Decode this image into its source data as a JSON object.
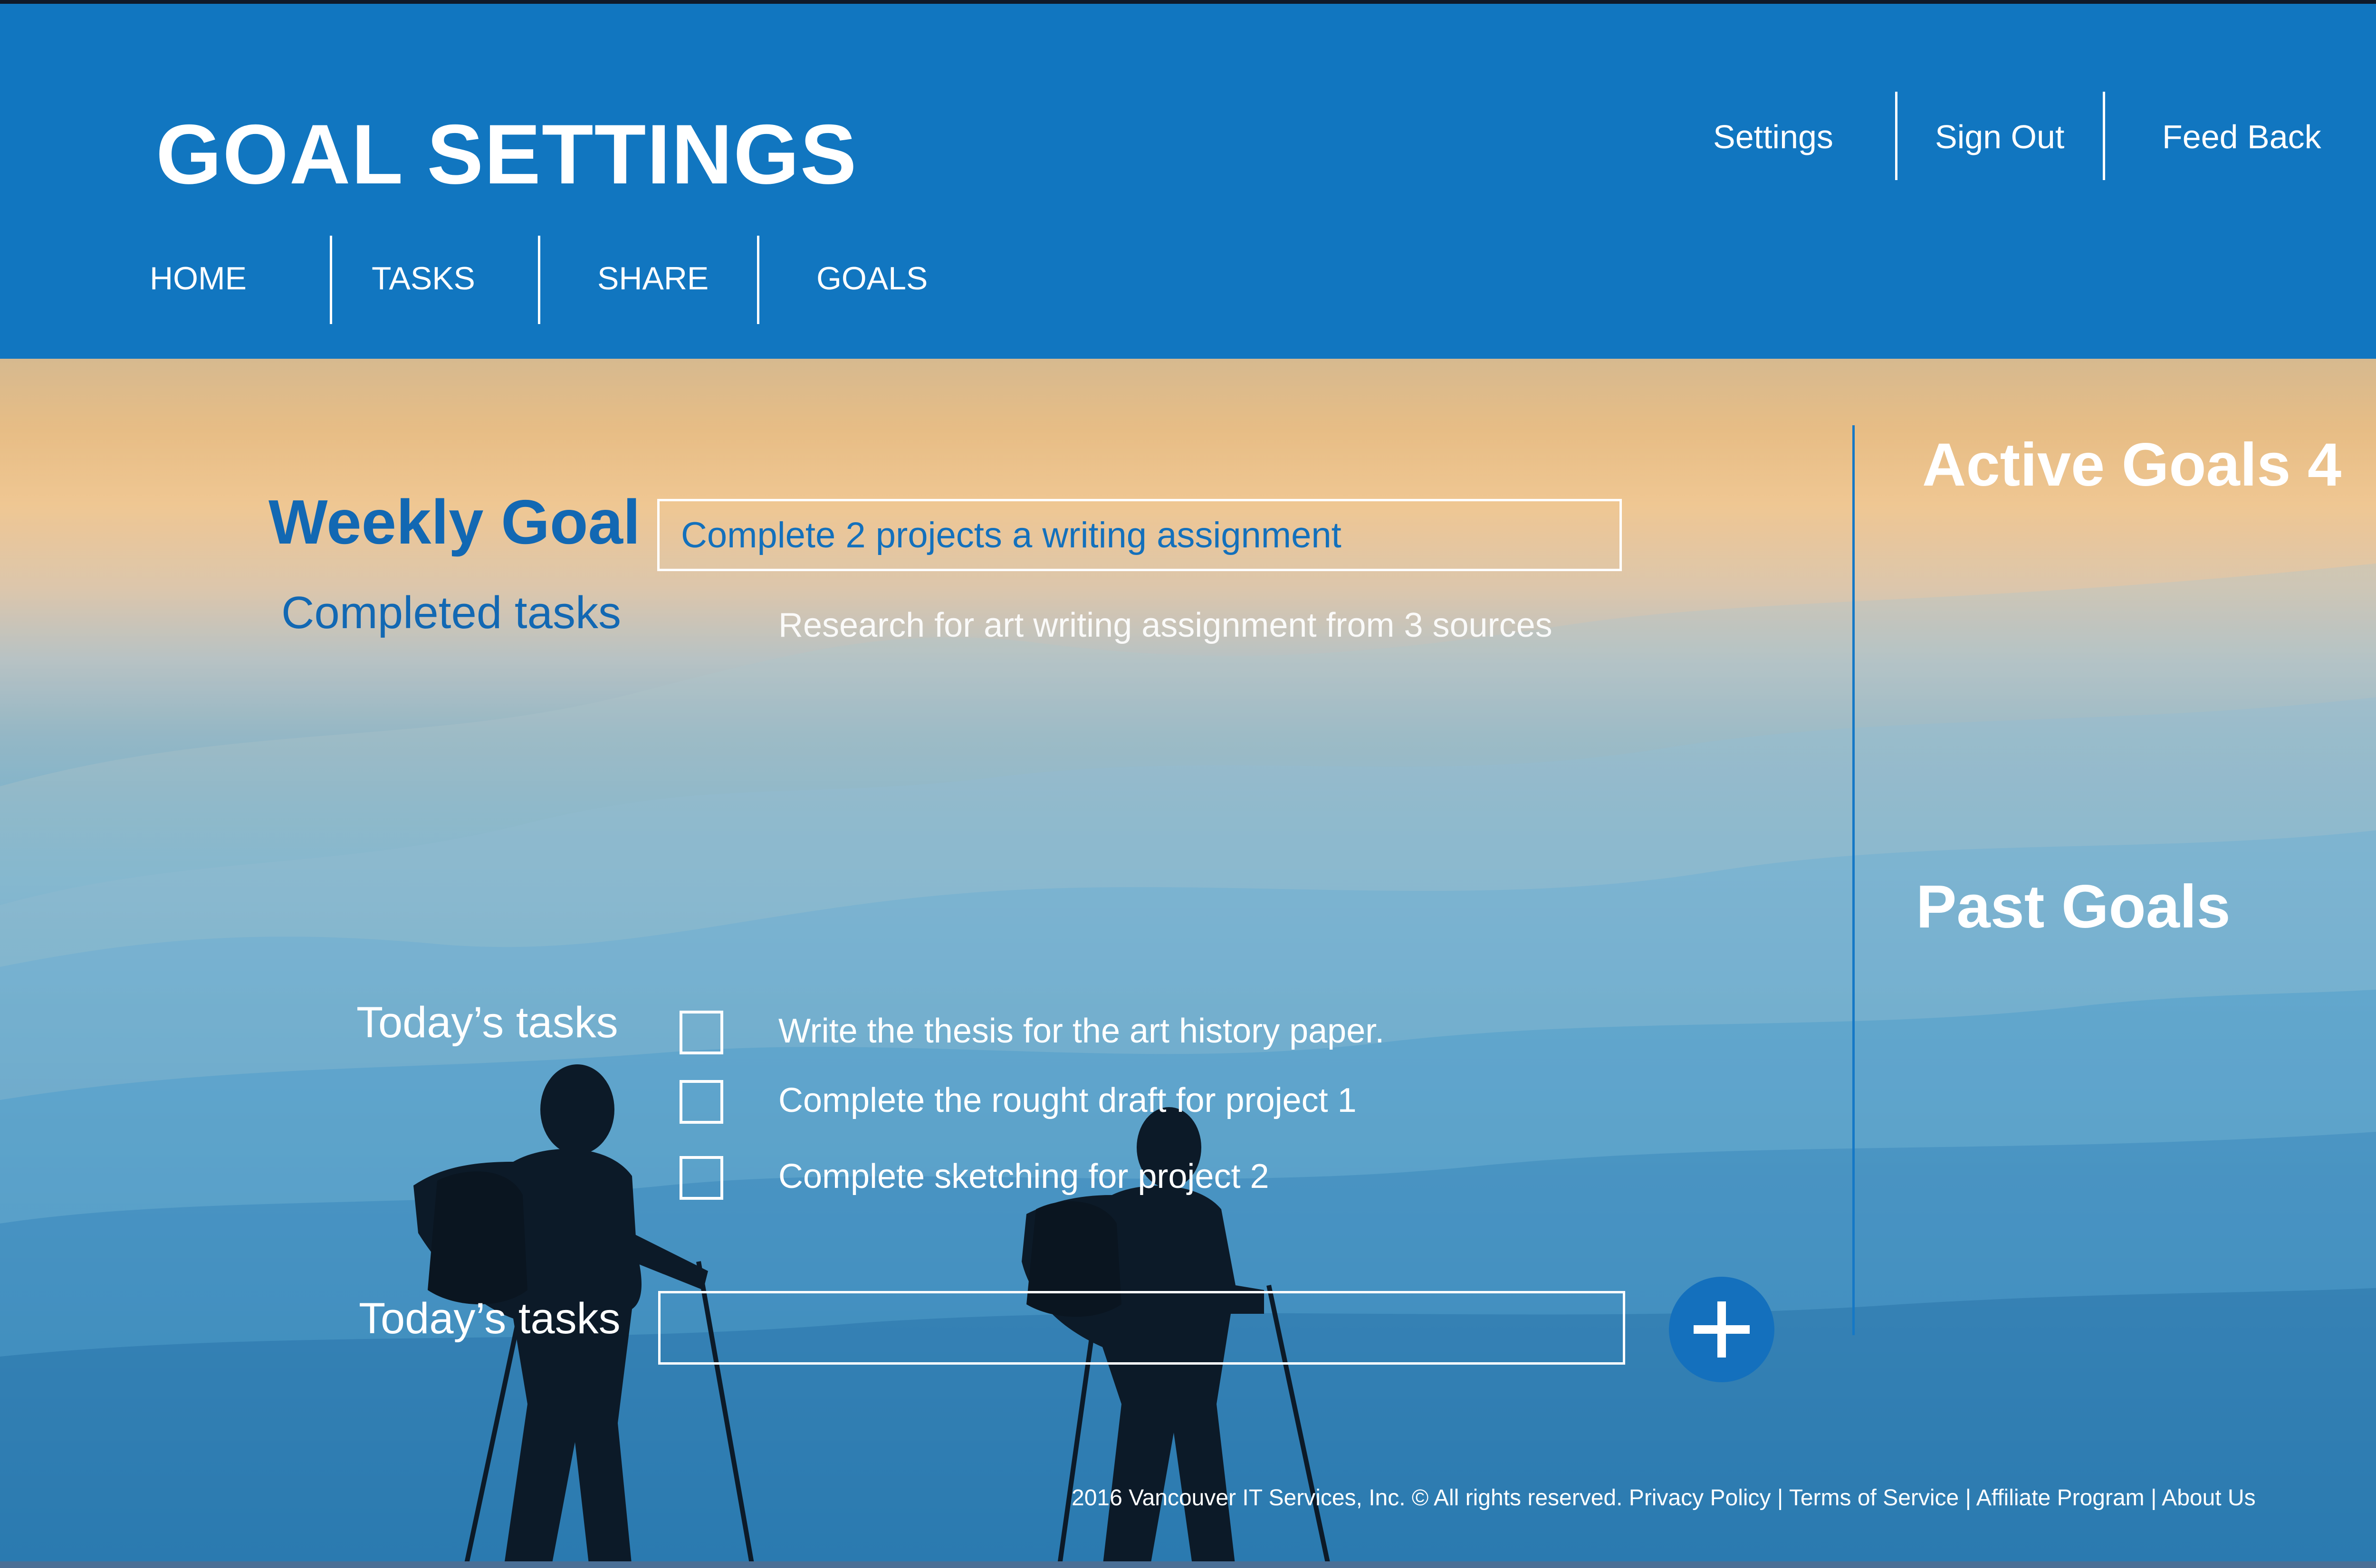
{
  "app": {
    "title": "GOAL SETTINGS"
  },
  "utility_nav": {
    "settings": "Settings",
    "sign_out": "Sign Out",
    "feedback": "Feed Back"
  },
  "main_nav": {
    "home": "HOME",
    "tasks": "TASKS",
    "share": "SHARE",
    "goals": "GOALS"
  },
  "weekly_goal": {
    "label": "Weekly Goal",
    "value": "Complete 2 projects a writing assignment"
  },
  "completed": {
    "label": "Completed tasks",
    "items": [
      "Research for art writing assignment from 3 sources"
    ]
  },
  "today": {
    "label": "Today’s tasks",
    "tasks": [
      {
        "text": "Write the thesis for the art history paper.",
        "checked": false
      },
      {
        "text": "Complete the rought draft for project 1",
        "checked": false
      },
      {
        "text": "Complete sketching for project 2",
        "checked": false
      }
    ],
    "input_label": "Today’s tasks",
    "input_value": "",
    "add_icon": "plus-icon"
  },
  "sidebar": {
    "active_goals": "Active Goals 4",
    "past_goals": "Past Goals"
  },
  "footer": {
    "copyright": "2016 Vancouver IT Services, Inc. © All rights reserved.",
    "links": [
      "Privacy Policy",
      "Terms of Service",
      "Affiliate Program",
      "About Us"
    ],
    "separator": " | "
  },
  "colors": {
    "header": "#1176c0",
    "accent_blue": "#1268b3",
    "add_button": "#1470bd"
  }
}
